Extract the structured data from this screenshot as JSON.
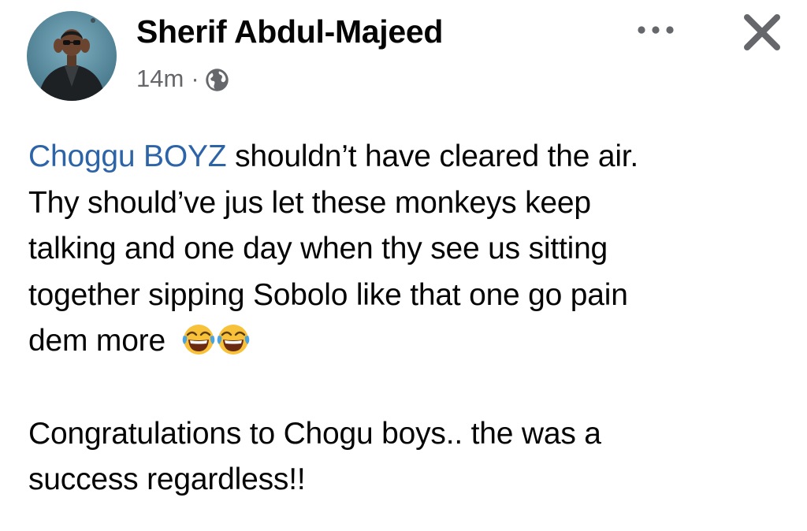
{
  "post": {
    "author": {
      "name": "Sherif Abdul-Majeed",
      "avatar_icon": "profile-photo"
    },
    "timestamp": "14m",
    "separator": "·",
    "audience_icon": "globe-icon",
    "actions": {
      "more_icon": "more-horizontal-icon",
      "close_icon": "close-icon"
    },
    "body": {
      "mention": "Choggu BOYZ",
      "line1_rest": " shouldn’t have cleared the air.",
      "line2": "Thy should’ve jus let these monkeys keep",
      "line3": "talking and one day when thy see us sitting",
      "line4": "together sipping Sobolo like that one go pain",
      "line5": "dem more",
      "emoji": "face-with-tears-of-joy",
      "emoji_count": 2,
      "paragraph2_line1": "Congratulations to Chogu boys.. the was a",
      "paragraph2_line2": "success regardless!!"
    }
  },
  "colors": {
    "text": "#050505",
    "muted": "#65676b",
    "link": "#2d64a7",
    "background": "#ffffff"
  }
}
